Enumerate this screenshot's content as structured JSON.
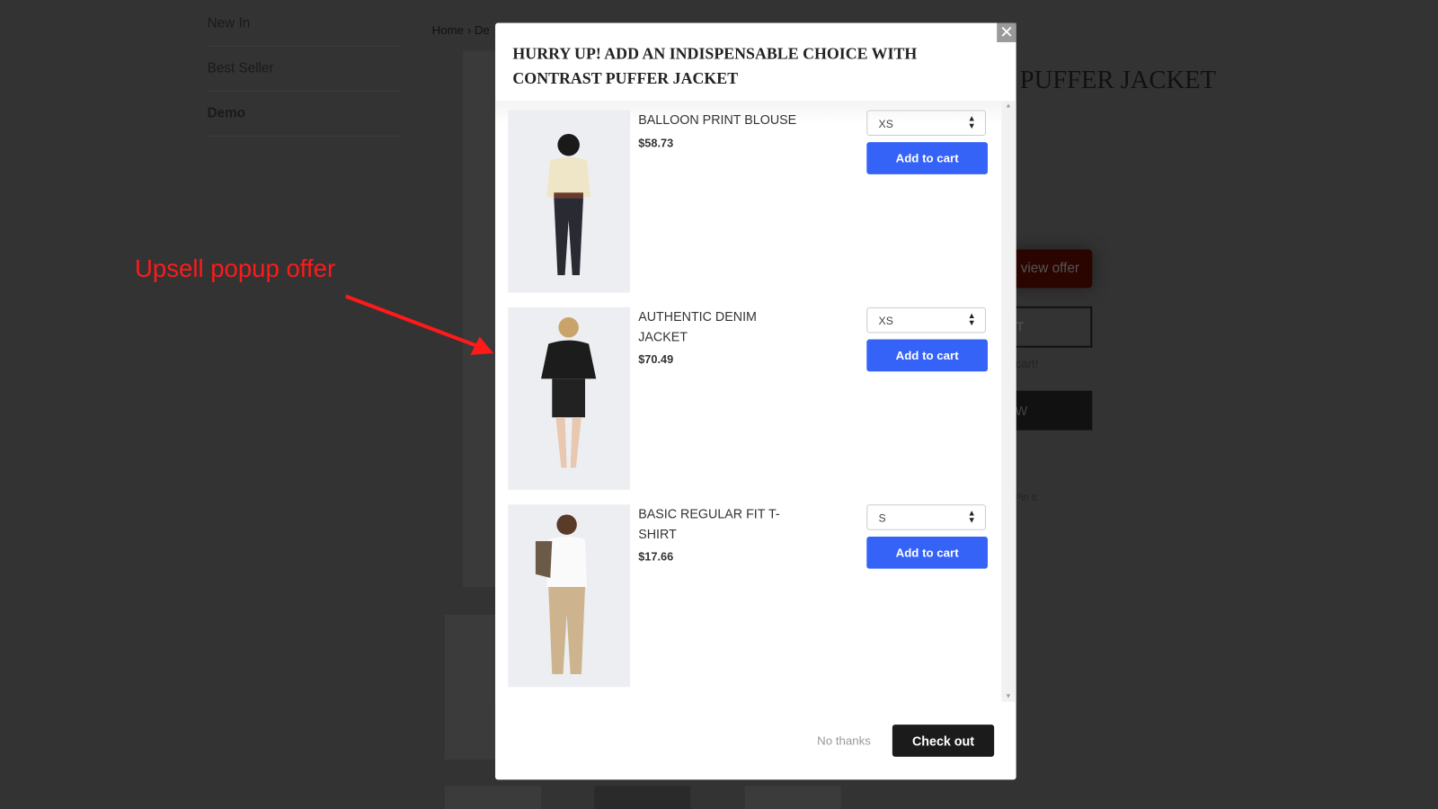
{
  "sidebar": {
    "items": [
      {
        "label": "New In"
      },
      {
        "label": "Best Seller"
      },
      {
        "label": "Demo"
      }
    ]
  },
  "breadcrumb": {
    "home": "Home",
    "separator": "›",
    "current": "De"
  },
  "background_product": {
    "title": "PUFFER JACKET",
    "view_offer": "view offer",
    "add_to_cart_partial": "T",
    "cart_note_partial": "cart!",
    "buy_now_partial": "W",
    "pin": "Pin it"
  },
  "annotation": {
    "text": "Upsell popup offer",
    "color": "#ff1a1a"
  },
  "modal": {
    "title": "HURRY UP! ADD AN INDISPENSABLE CHOICE WITH CONTRAST PUFFER JACKET",
    "close_icon": "close-icon",
    "products": [
      {
        "name": "BALLOON PRINT BLOUSE",
        "price": "$58.73",
        "size": "XS",
        "button": "Add to cart"
      },
      {
        "name": "AUTHENTIC DENIM JACKET",
        "price": "$70.49",
        "size": "XS",
        "button": "Add to cart"
      },
      {
        "name": "BASIC REGULAR FIT T-SHIRT",
        "price": "$17.66",
        "size": "S",
        "button": "Add to cart"
      }
    ],
    "no_thanks": "No thanks",
    "checkout": "Check out",
    "accent_color": "#3563f7"
  }
}
